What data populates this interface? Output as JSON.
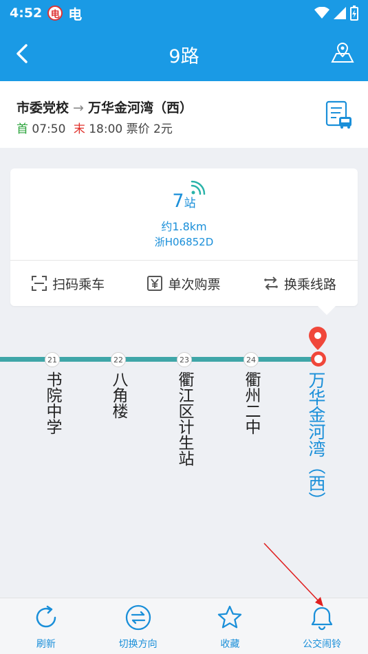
{
  "status": {
    "time": "4:52",
    "app_badge": "电",
    "app2": "电"
  },
  "header": {
    "title": "9路"
  },
  "route_info": {
    "from": "市委党校",
    "arrow": "→",
    "to": "万华金河湾（西）",
    "first_label": "首",
    "first_time": "07:50",
    "last_label": "末",
    "last_time": "18:00",
    "fare": "票价 2元"
  },
  "bus_card": {
    "stops_count": "7",
    "stops_unit": "站",
    "distance": "约1.8km",
    "plate": "浙H06852D",
    "actions": [
      {
        "label": "扫码乘车",
        "icon": "scan-icon"
      },
      {
        "label": "单次购票",
        "icon": "yen-ticket-icon"
      },
      {
        "label": "换乘线路",
        "icon": "transfer-icon"
      }
    ]
  },
  "stations": [
    {
      "index": "21",
      "name": "书院中学"
    },
    {
      "index": "22",
      "name": "八角楼"
    },
    {
      "index": "23",
      "name": "衢江区计生站"
    },
    {
      "index": "24",
      "name": "衢州二中"
    },
    {
      "index": "",
      "name": "万华金河湾（西）",
      "current": true
    }
  ],
  "tabbar": [
    {
      "label": "刷新",
      "icon": "refresh-icon"
    },
    {
      "label": "切换方向",
      "icon": "swap-direction-icon"
    },
    {
      "label": "收藏",
      "icon": "star-icon"
    },
    {
      "label": "公交闹铃",
      "icon": "bell-icon"
    }
  ],
  "colors": {
    "primary": "#1a9ae5",
    "line": "#3fa6a8",
    "current": "#f0473a",
    "first_time": "#2aa33a",
    "last_time": "#e0312b"
  }
}
